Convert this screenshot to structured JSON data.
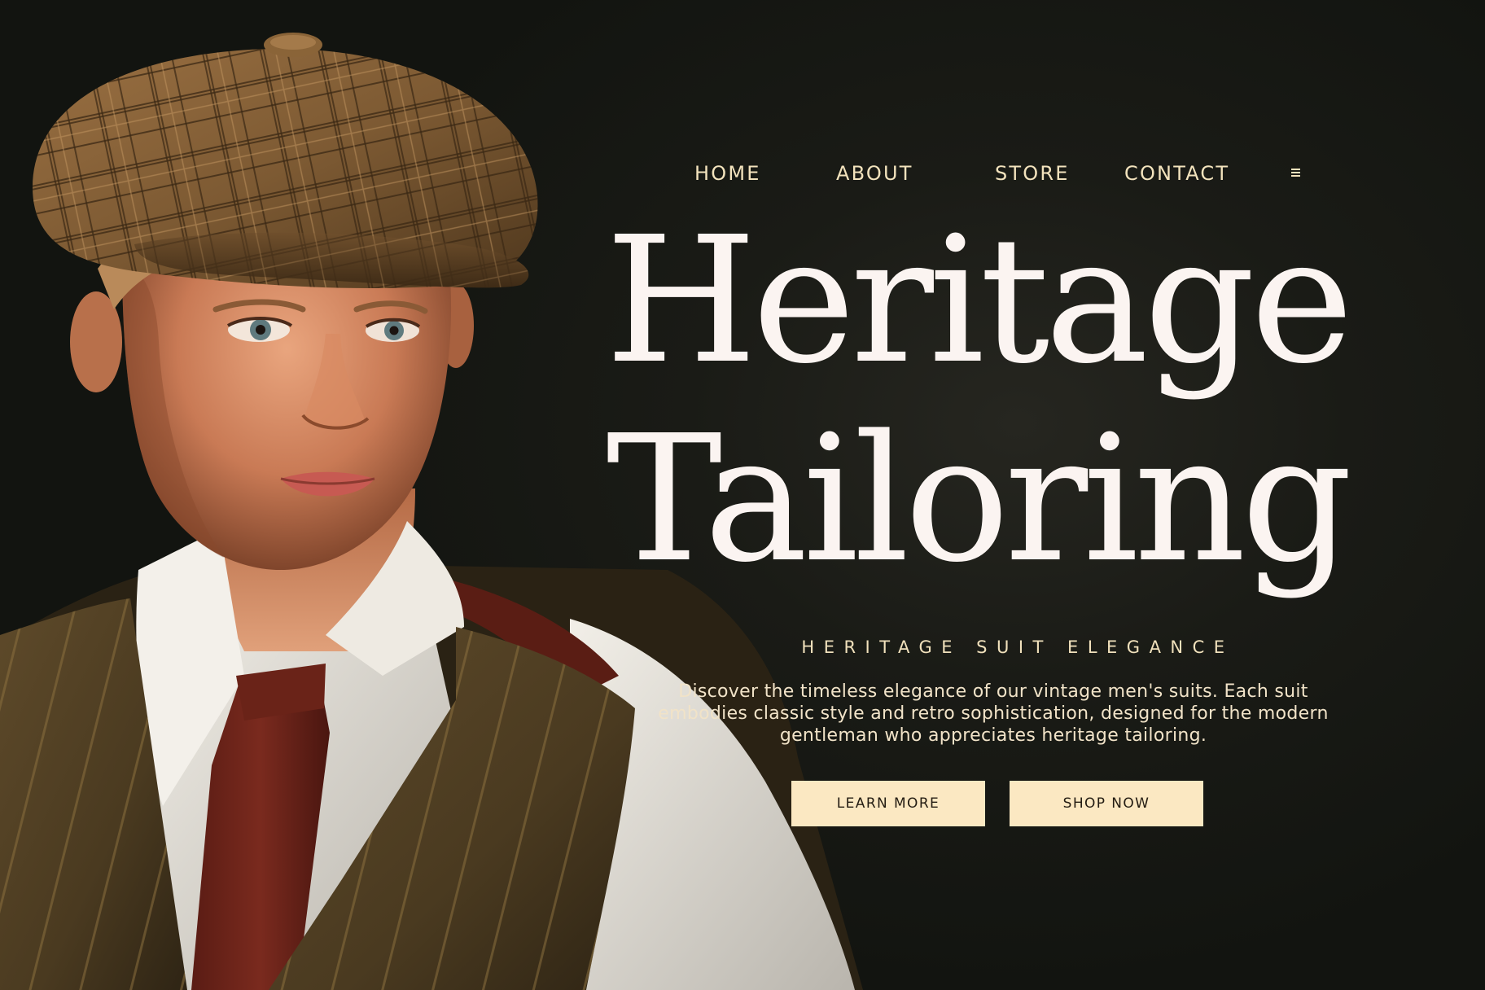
{
  "nav": {
    "items": [
      {
        "label": "HOME"
      },
      {
        "label": "ABOUT"
      },
      {
        "label": "STORE"
      },
      {
        "label": "CONTACT"
      }
    ],
    "menu_icon": "hamburger-menu-icon"
  },
  "hero": {
    "title_line1": "Heritage",
    "title_line2": "Tailoring",
    "tagline": "HERITAGE SUIT ELEGANCE",
    "description": "Discover the timeless elegance of our vintage men's suits. Each suit embodies classic style and retro sophistication, designed for the modern gentleman who appreciates heritage tailoring.",
    "buttons": {
      "learn_more": "LEARN MORE",
      "shop_now": "SHOP NOW"
    }
  },
  "colors": {
    "background": "#161812",
    "title": "#fbf4f1",
    "nav_text": "#f3e3bd",
    "button_background": "#fbe8c2",
    "button_text": "#231c12"
  }
}
